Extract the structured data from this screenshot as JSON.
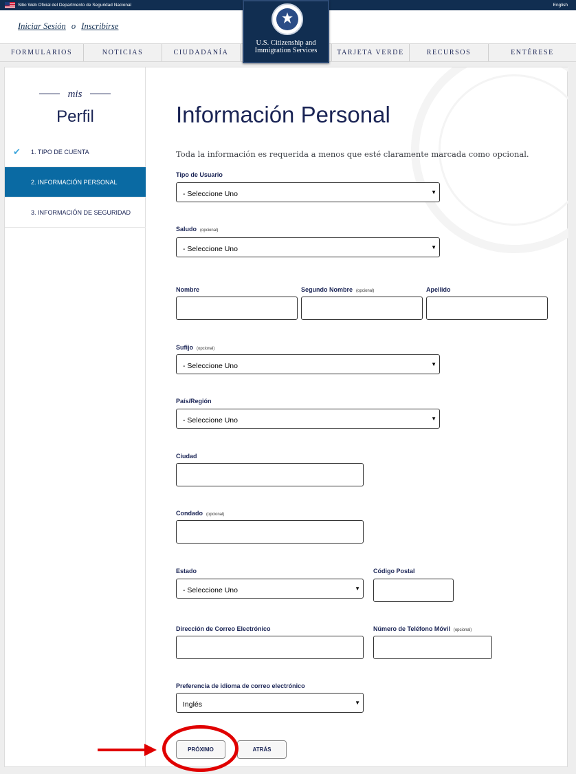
{
  "topbar": {
    "official": "Sitio Web Oficial del Departmento de Seguridad Nacional",
    "language": "English"
  },
  "header": {
    "login": "Iniciar Sesión",
    "or": "o",
    "register": "Inscribirse"
  },
  "logo": {
    "line1": "U.S. Citizenship and",
    "line2": "Immigration Services"
  },
  "nav": {
    "items": [
      "FORMULARIOS",
      "NOTICIAS",
      "CIUDADANÍA",
      "TARJETA VERDE",
      "RECURSOS",
      "ENTÉRESE"
    ]
  },
  "sidebar": {
    "brand_script": "mis",
    "brand": "Perfil",
    "steps": [
      {
        "label": "1.  TIPO DE CUENTA",
        "done": true
      },
      {
        "label": "2.  INFORMACIÓN PERSONAL",
        "active": true
      },
      {
        "label": "3.  INFORMACIÓN DE SEGURIDAD"
      }
    ]
  },
  "form": {
    "title": "Información Personal",
    "description": "Toda la información es requerida a menos que esté claramente marcada como opcional.",
    "optional_tag": "(opcional)",
    "user_type": {
      "label": "Tipo de Usuario",
      "value": "- Seleccione Uno"
    },
    "greeting": {
      "label": "Saludo",
      "value": "- Seleccione Uno"
    },
    "first_name": {
      "label": "Nombre",
      "value": ""
    },
    "middle_name": {
      "label": "Segundo Nombre",
      "value": ""
    },
    "last_name": {
      "label": "Apellido",
      "value": ""
    },
    "suffix": {
      "label": "Sufijo",
      "value": "- Seleccione Uno"
    },
    "country": {
      "label": "País/Región",
      "value": "- Seleccione Uno"
    },
    "city": {
      "label": "Ciudad",
      "value": ""
    },
    "county": {
      "label": "Condado",
      "value": ""
    },
    "state": {
      "label": "Estado",
      "value": "- Seleccione Uno"
    },
    "zip": {
      "label": "Código Postal",
      "value": ""
    },
    "email": {
      "label": "Dirección de Correo Electrónico",
      "value": ""
    },
    "mobile": {
      "label": "Número de Teléfono Móvil",
      "value": ""
    },
    "email_lang": {
      "label": "Preferencia de idioma de correo electrónico",
      "value": "Inglés"
    },
    "next_button": "PRÓXIMO",
    "back_button": "ATRÁS"
  },
  "colors": {
    "navy": "#112e51",
    "active_step": "#0a6aa3",
    "annotation": "#e00000"
  }
}
